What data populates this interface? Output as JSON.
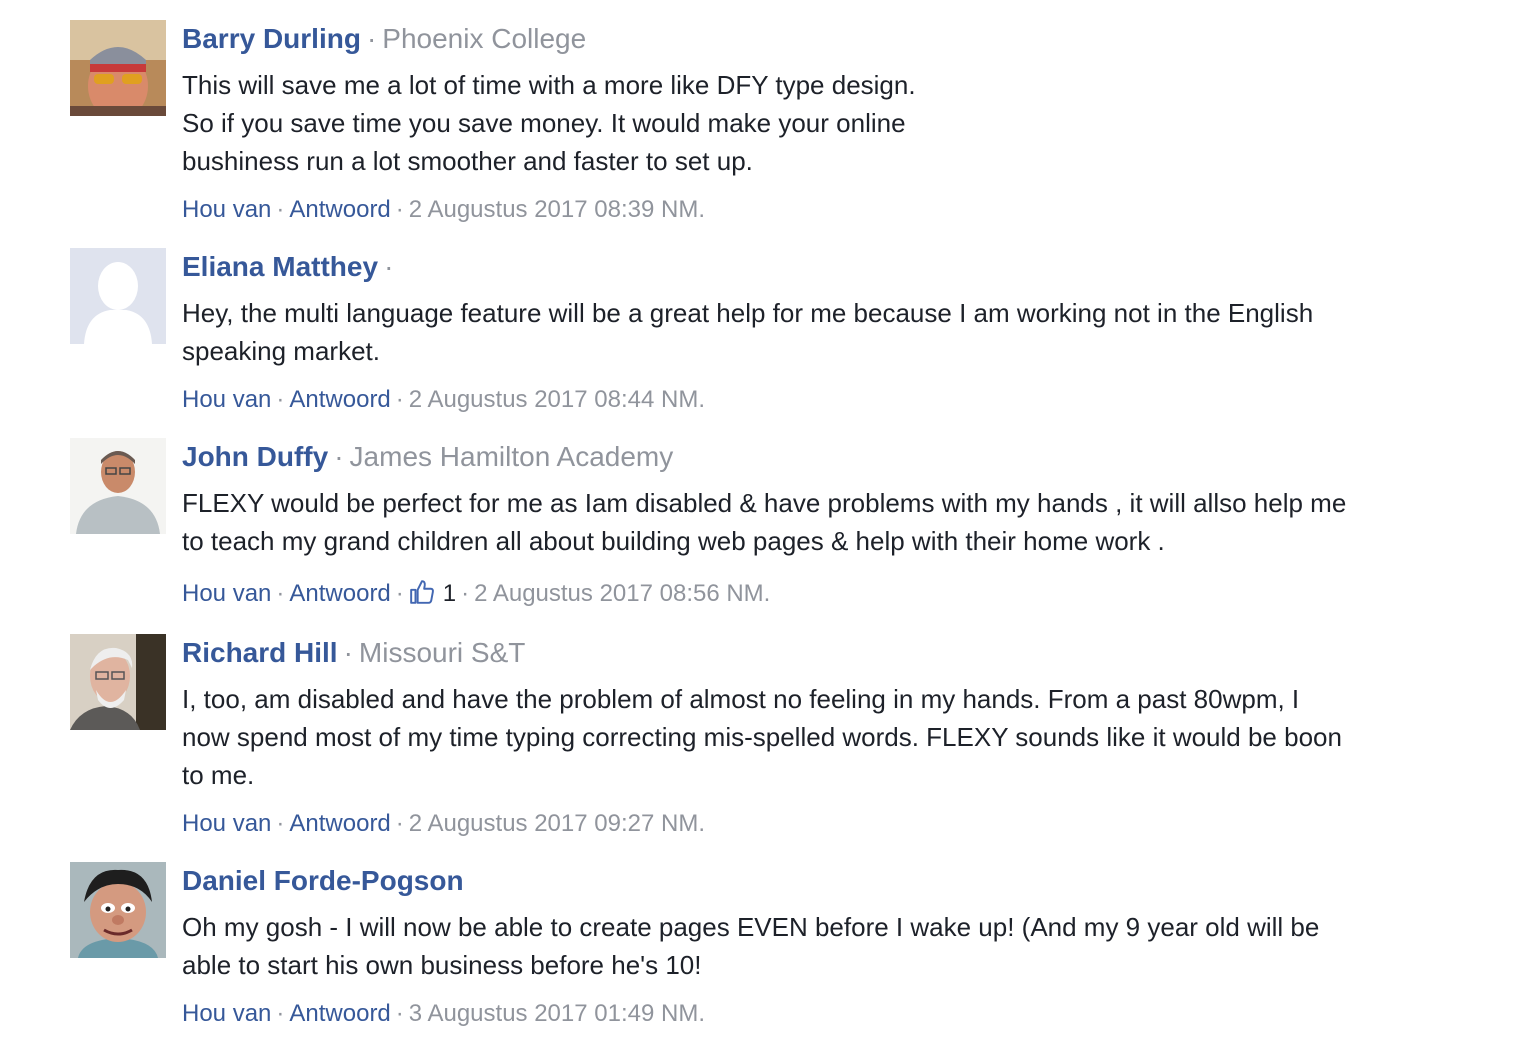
{
  "comments": [
    {
      "author": "Barry Durling",
      "affiliation": "Phoenix College",
      "text": "This will save me a lot of time with a more like DFY type design.\nSo if you save time you save money. It would make your online\nbushiness run a lot smoother and faster to set up.",
      "like_label": "Hou van",
      "reply_label": "Antwoord",
      "likes": "",
      "timestamp": "2 Augustus 2017 08:39 NM."
    },
    {
      "author": "Eliana Matthey",
      "affiliation": "",
      "text": "Hey, the multi language feature will be a great help for me because I am working not in the English\nspeaking market.",
      "like_label": "Hou van",
      "reply_label": "Antwoord",
      "likes": "",
      "timestamp": "2 Augustus 2017 08:44 NM."
    },
    {
      "author": "John Duffy",
      "affiliation": "James Hamilton Academy",
      "text": "FLEXY would be perfect for me as Iam disabled & have problems with my hands , it will allso help me\nto teach my grand children all about building web pages & help with their home work .",
      "like_label": "Hou van",
      "reply_label": "Antwoord",
      "likes": "1",
      "timestamp": "2 Augustus 2017 08:56 NM."
    },
    {
      "author": "Richard Hill",
      "affiliation": "Missouri S&T",
      "text": "I, too, am disabled and have the problem of almost no feeling in my hands. From a past 80wpm, I\nnow spend most of my time typing correcting mis-spelled words. FLEXY sounds like it would be boon\nto me.",
      "like_label": "Hou van",
      "reply_label": "Antwoord",
      "likes": "",
      "timestamp": "2 Augustus 2017 09:27 NM."
    },
    {
      "author": "Daniel Forde-Pogson",
      "affiliation": "",
      "text": "Oh my gosh - I will now be able to create pages EVEN before I wake up! (And my 9 year old will be\nable to start his own business before he's 10!",
      "like_label": "Hou van",
      "reply_label": "Antwoord",
      "likes": "",
      "timestamp": "3 Augustus 2017 01:49 NM."
    }
  ],
  "colors": {
    "link": "#365899",
    "meta": "#90949c",
    "text": "#1d2129"
  },
  "icons": {
    "like": "thumbs-up-icon"
  }
}
